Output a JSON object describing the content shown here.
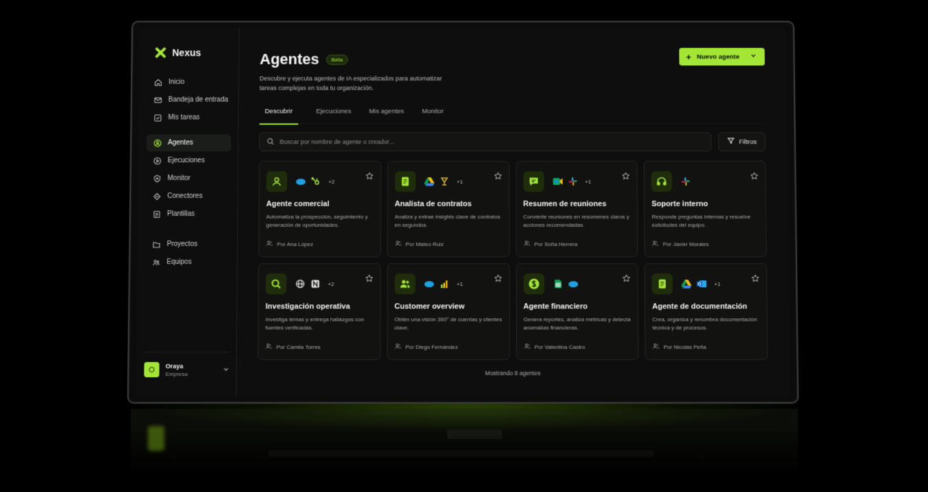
{
  "app": {
    "name": "Nexus"
  },
  "sidebar": {
    "items": [
      {
        "label": "Inicio",
        "icon": "home-icon"
      },
      {
        "label": "Bandeja de entrada",
        "icon": "mail-icon"
      },
      {
        "label": "Mis tareas",
        "icon": "task-check-icon"
      },
      {
        "label": "Agentes",
        "icon": "agent-icon",
        "active": true
      },
      {
        "label": "Ejecuciones",
        "icon": "play-icon"
      },
      {
        "label": "Monitor",
        "icon": "shield-icon"
      },
      {
        "label": "Conectores",
        "icon": "connector-icon"
      },
      {
        "label": "Plantillas",
        "icon": "template-icon"
      },
      {
        "label": "Proyectos",
        "icon": "folder-icon"
      },
      {
        "label": "Equipos",
        "icon": "team-icon"
      }
    ],
    "user": {
      "name": "Oraya",
      "plan": "Empresa"
    }
  },
  "header": {
    "title": "Agentes",
    "badge": "Beta",
    "subtitle": "Descubre y ejecuta agentes de IA especializados para automatizar tareas complejas en toda tu organización.",
    "new_button": "Nuevo agente"
  },
  "tabs": [
    {
      "label": "Descubrir",
      "active": true
    },
    {
      "label": "Ejecuciones"
    },
    {
      "label": "Mis agentes"
    },
    {
      "label": "Monitor"
    }
  ],
  "search": {
    "placeholder": "Buscar por nombre de agente o creador...",
    "filters_label": "Filtros"
  },
  "agents": [
    {
      "title": "Agente comercial",
      "desc": "Automatiza la prospección, seguimiento y generación de oportunidades.",
      "author": "Por Ana López",
      "icon": "user-icon",
      "apps": [
        "salesforce-icon",
        "hubspot-icon"
      ],
      "more": "+2"
    },
    {
      "title": "Analista de contratos",
      "desc": "Analiza y extrae insights clave de contratos en segundos.",
      "author": "Por Mateo Ruiz",
      "icon": "document-icon",
      "apps": [
        "google-drive-icon",
        "docusign-icon"
      ],
      "more": "+1"
    },
    {
      "title": "Resumen de reuniones",
      "desc": "Convierte reuniones en resúmenes claros y acciones recomendadas.",
      "author": "Por Sofía Herrera",
      "icon": "chat-icon",
      "apps": [
        "google-meet-icon",
        "slack-icon"
      ],
      "more": "+1"
    },
    {
      "title": "Soporte interno",
      "desc": "Responde preguntas internas y resuelve solicitudes del equipo.",
      "author": "Por Javier Morales",
      "icon": "headset-icon",
      "apps": [
        "slack-icon"
      ],
      "more": ""
    },
    {
      "title": "Investigación operativa",
      "desc": "Investiga temas y entrega hallazgos con fuentes verificadas.",
      "author": "Por Camila Torres",
      "icon": "search-icon",
      "apps": [
        "globe-icon",
        "notion-icon"
      ],
      "more": "+2"
    },
    {
      "title": "Customer overview",
      "desc": "Obtén una visión 360° de cuentas y clientes clave.",
      "author": "Por Diego Fernández",
      "icon": "users-icon",
      "apps": [
        "salesforce-icon",
        "powerbi-icon"
      ],
      "more": "+1"
    },
    {
      "title": "Agente financiero",
      "desc": "Genera reportes, analiza métricas y detecta anomalías financieras.",
      "author": "Por Valentina Castro",
      "icon": "dollar-icon",
      "apps": [
        "google-sheets-icon",
        "salesforce-icon"
      ],
      "more": ""
    },
    {
      "title": "Agente de documentación",
      "desc": "Crea, organiza y renombra documentación técnica y de procesos.",
      "author": "Por Nicolás Peña",
      "icon": "document-icon",
      "apps": [
        "google-drive-icon",
        "outlook-icon"
      ],
      "more": "+1"
    }
  ],
  "footer": {
    "count_text": "Mostrando 8 agentes"
  },
  "colors": {
    "accent": "#a3e635",
    "background": "#0d0e0d",
    "card": "#121311"
  }
}
